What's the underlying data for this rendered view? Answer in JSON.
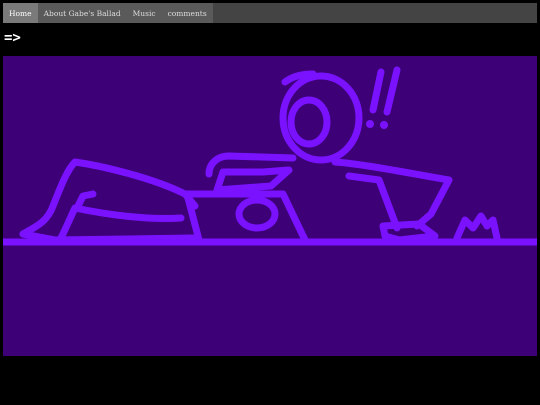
{
  "nav": {
    "items": [
      {
        "label": "Home"
      },
      {
        "label": "About Gabe's Ballad"
      },
      {
        "label": "Music"
      },
      {
        "label": "comments"
      }
    ]
  },
  "next": {
    "label": "=>"
  },
  "comic": {
    "exclamation": "!!",
    "colors": {
      "background": "#3d0077",
      "stroke": "#7a12ff"
    }
  }
}
